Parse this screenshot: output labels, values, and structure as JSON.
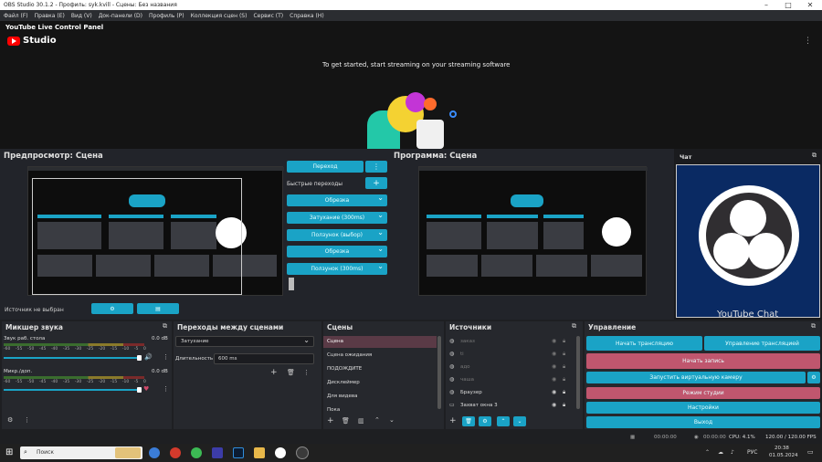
{
  "window": {
    "title": "OBS Studio 30.1.2 - Профиль: syk.kvill - Сцены: Без названия"
  },
  "menu": [
    "Файл (F)",
    "Правка (E)",
    "Вид (V)",
    "Док-панели (D)",
    "Профиль (P)",
    "Коллекция сцен (S)",
    "Сервис (T)",
    "Справка (H)"
  ],
  "yt_panel": {
    "title": "YouTube Live Control Panel",
    "logo_text": "Studio",
    "message": "To get started, start streaming on your streaming software"
  },
  "preview": {
    "title": "Предпросмотр: Сцена",
    "status": "Источник не выбран"
  },
  "program": {
    "title": "Программа: Сцена"
  },
  "transitions_mid": {
    "transition_btn": "Переход",
    "quick_label": "Быстрые переходы",
    "items": [
      "Обрезка",
      "Затухание (300ms)",
      "Ползунок (выбор)",
      "Обрезка",
      "Ползунок (300ms)"
    ]
  },
  "chat": {
    "title": "Чат",
    "overlay_text": "YouTube Chat"
  },
  "mixer": {
    "title": "Микшер звука",
    "channels": [
      {
        "name": "Звук раб. стола",
        "level": "0.0 dB"
      },
      {
        "name": "Микр./доп.",
        "level": "0.0 dB"
      }
    ],
    "ticks": [
      "-60",
      "-55",
      "-50",
      "-45",
      "-40",
      "-35",
      "-30",
      "-25",
      "-20",
      "-15",
      "-10",
      "-5",
      "0"
    ]
  },
  "scene_transitions": {
    "title": "Переходы между сценами",
    "selected": "Затухание",
    "duration_label": "Длительность",
    "duration_value": "600 ms"
  },
  "scenes": {
    "title": "Сцены",
    "items": [
      "Сцена",
      "Сцена ожидания",
      "ПОДОЖДИТЕ",
      "Дисклеймер",
      "Для видева",
      "Пока"
    ]
  },
  "sources": {
    "title": "Источники",
    "items": [
      "заказ",
      "ti",
      "адо",
      "чаша",
      "Браузер",
      "Захват окна 3"
    ]
  },
  "controls": {
    "title": "Управление",
    "start_stream": "Начать трансляцию",
    "manage_stream": "Управление трансляцией",
    "start_record": "Начать запись",
    "virtual_cam": "Запустить виртуальную камеру",
    "studio_mode": "Режим студии",
    "settings": "Настройки",
    "exit": "Выход"
  },
  "statusbar": {
    "time": "00:00:00",
    "time2": "00:00:00",
    "cpu": "CPU: 4.1%",
    "fps": "120.00 / 120.00 FPS"
  },
  "taskbar": {
    "search": "Поиск",
    "lang": "РУС",
    "clock": "20:38",
    "date": "01.05.2024"
  },
  "colors": {
    "accent": "#1aa3c6",
    "record": "#c0566e",
    "bg": "#1e1f22"
  }
}
